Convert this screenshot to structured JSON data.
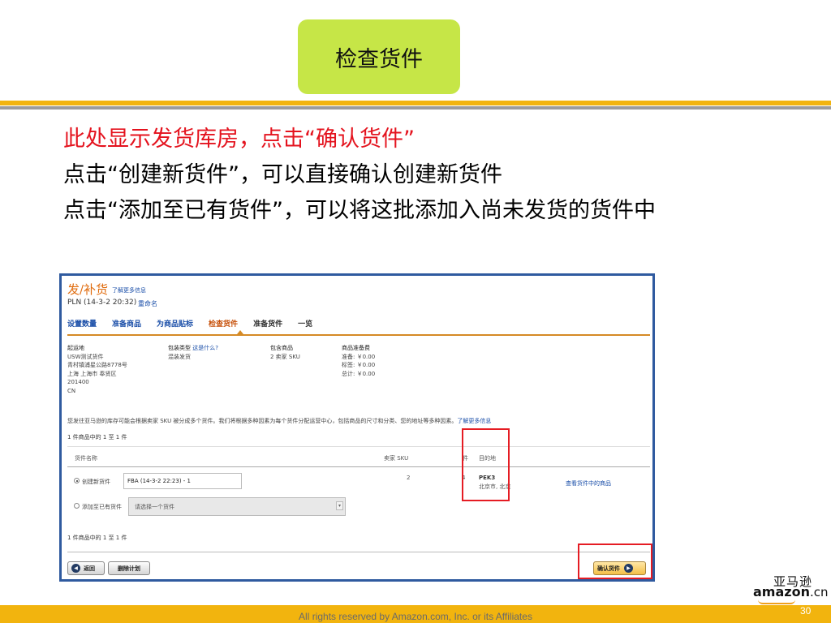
{
  "slide": {
    "title": "检查货件",
    "bullets": [
      "此处显示发货库房，点击“确认货件”",
      "点击“创建新货件”，可以直接确认创建新货件",
      "点击“添加至已有货件”，可以将这批添加入尚未发货的货件中"
    ],
    "footer": "All rights reserved by Amazon.com, Inc. or its Affiliates",
    "page_number": "30",
    "colors": {
      "title_bg": "#c6e647",
      "accent": "#f2b40e",
      "bullet_highlight": "#e4131e",
      "highlight_box": "#e51c23"
    }
  },
  "brand": {
    "cn": "亚马逊",
    "word": "amazon",
    "suffix": ".cn"
  },
  "screenshot": {
    "title": "发/补货",
    "learn_more": "了解更多信息",
    "plan_name": "PLN (14-3-2 20:32)",
    "rename": "重命名",
    "tabs": [
      "设置数量",
      "准备商品",
      "为商品贴标",
      "检查货件",
      "准备货件",
      "一览"
    ],
    "summary": {
      "ship_from": {
        "header": "起运地",
        "lines": [
          "USW测试货件",
          "青村镇浦星公路8778号",
          "上海 上海市 奉贤区",
          "201400",
          "CN"
        ]
      },
      "packing": {
        "header": "包装类型",
        "link": "这是什么?",
        "value": "混装发货"
      },
      "contents": {
        "header": "包含商品",
        "value": "2 卖家 SKU"
      },
      "prep_fees": {
        "header": "商品准备费",
        "lines": [
          "准备: ￥0.00",
          "标签: ￥0.00",
          "总计: ￥0.00"
        ]
      }
    },
    "notice": "您发往亚马逊的库存可能会根据卖家 SKU 被分成多个货件。我们将根据多种因素为每个货件分配运营中心，包括商品的尺寸和分类、您的地址等多种因素。",
    "notice_link": "了解更多信息",
    "count_text": "1 件商品中的 1 至 1 件",
    "table": {
      "headers": {
        "name": "货件名称",
        "sku": "卖家 SKU",
        "units": "件",
        "destination": "目的地"
      },
      "rows": [
        {
          "option": "创建新货件",
          "input_value": "FBA (14-3-2 22:23) - 1",
          "sku": "2",
          "units": "4",
          "dest_code": "PEK3",
          "dest_city": "北京市, 北京",
          "action": "查看货件中的商品"
        }
      ],
      "add_existing": {
        "option": "添加至已有货件",
        "select_placeholder": "请选择一个货件"
      }
    },
    "buttons": {
      "back": "返回",
      "delete": "删除计划",
      "confirm": "确认货件"
    },
    "icons": {
      "back": "arrow-left-icon",
      "confirm": "arrow-right-icon"
    }
  }
}
